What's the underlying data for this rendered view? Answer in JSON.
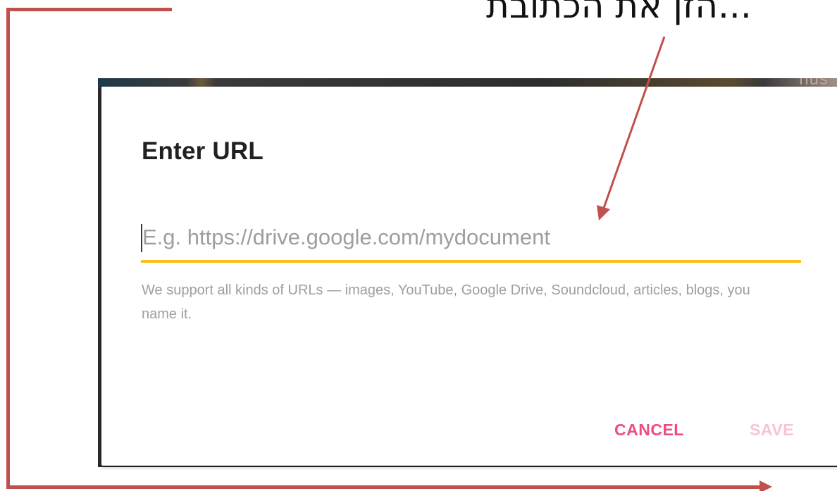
{
  "annotation": {
    "caption": "...הזן את הכתובת",
    "accent_color": "#c0504d"
  },
  "background_app": {
    "partial_text": "nus"
  },
  "dialog": {
    "title": "Enter URL",
    "url_input": {
      "value": "",
      "placeholder": "E.g. https://drive.google.com/mydocument"
    },
    "helper_text": "We support all kinds of URLs — images, YouTube, Google Drive, Soundcloud, articles, blogs, you name it.",
    "buttons": {
      "cancel_label": "CANCEL",
      "save_label": "SAVE"
    },
    "colors": {
      "focus_underline": "#f9c01b",
      "primary_action": "#ef4c7f",
      "disabled_action": "#f8c3d6"
    }
  }
}
